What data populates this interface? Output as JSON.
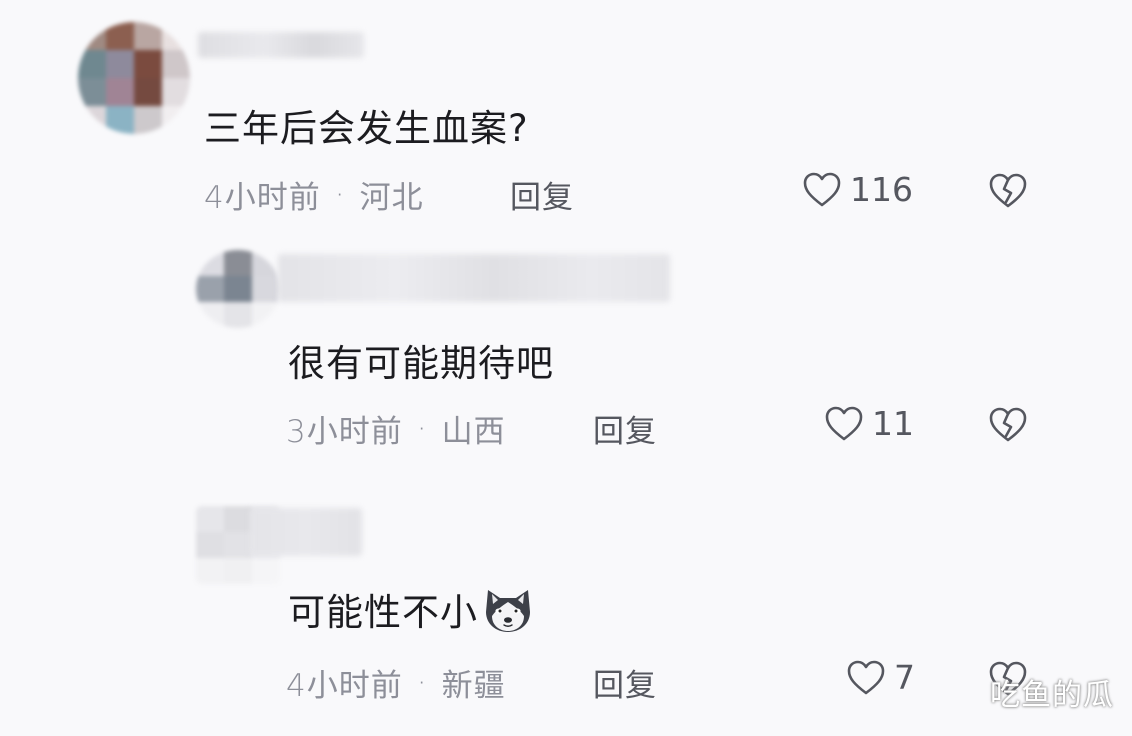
{
  "colors": {
    "background": "#f9f9fb",
    "text_primary": "#1c1c20",
    "text_meta": "#8d8f99",
    "icon": "#55575f"
  },
  "comments": [
    {
      "content": "三年后会发生血案?",
      "time": "4小时前",
      "location": "河北",
      "reply_label": "回复",
      "likes": "116",
      "like_icon": "heart-icon",
      "dislike_icon": "broken-heart-icon"
    },
    {
      "content": "很有可能期待吧",
      "time": "3小时前",
      "location": "山西",
      "reply_label": "回复",
      "likes": "11",
      "like_icon": "heart-icon",
      "dislike_icon": "broken-heart-icon"
    },
    {
      "content": "可能性不小",
      "content_emoji": "husky-emoji-icon",
      "time": "4小时前",
      "location": "新疆",
      "reply_label": "回复",
      "likes": "7",
      "like_icon": "heart-icon",
      "dislike_icon": "broken-heart-icon"
    }
  ],
  "separator": "·",
  "watermark": "吃鱼的瓜"
}
